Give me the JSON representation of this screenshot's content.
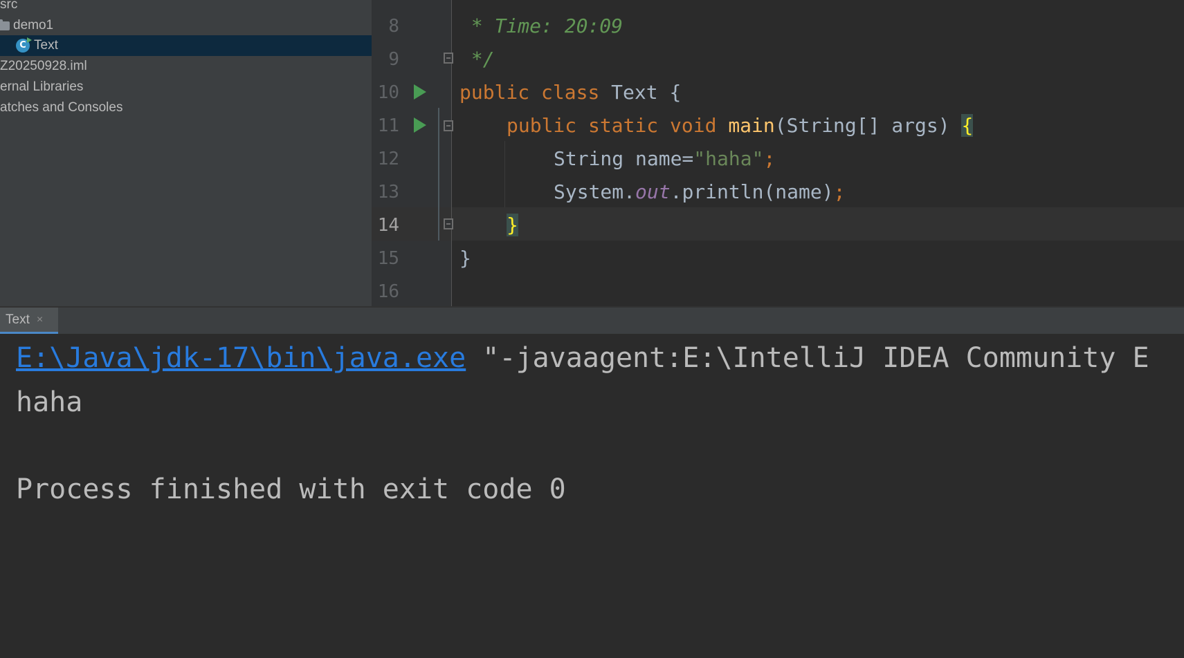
{
  "project_tree": {
    "items": [
      {
        "label": "src"
      },
      {
        "label": "demo1"
      },
      {
        "label": "Text"
      },
      {
        "label": "Z20250928.iml"
      },
      {
        "label": "ernal Libraries"
      },
      {
        "label": "atches and Consoles"
      }
    ]
  },
  "editor": {
    "line_numbers": [
      "8",
      "9",
      "10",
      "11",
      "12",
      "13",
      "14",
      "15",
      "16"
    ],
    "code": {
      "l8_comment": " * Time: 20:09",
      "l9_comment": " */",
      "l10_public": "public",
      "l10_class": "class",
      "l10_name": "Text {",
      "l11_public": "public",
      "l11_static": "static",
      "l11_void": "void",
      "l11_main": "main",
      "l11_params": "(String[] args) ",
      "l11_brace": "{",
      "l12_decl": "String name=",
      "l12_str": "\"haha\"",
      "l12_semi": ";",
      "l13_sys": "System.",
      "l13_out": "out",
      "l13_call": ".println(name)",
      "l13_semi": ";",
      "l14_brace": "}",
      "l15_brace": "}"
    }
  },
  "run_panel": {
    "tab_label": "Text",
    "close_glyph": "×",
    "console": {
      "java_path": "E:\\Java\\jdk-17\\bin\\java.exe",
      "java_args": " \"-javaagent:E:\\IntelliJ IDEA Community E",
      "output": "haha",
      "exit_message": "Process finished with exit code 0"
    }
  },
  "colors": {
    "keyword": "#cc7832",
    "function": "#ffc66d",
    "string": "#6a8759",
    "comment": "#629755",
    "link": "#287bde",
    "run_icon": "#499c54"
  }
}
